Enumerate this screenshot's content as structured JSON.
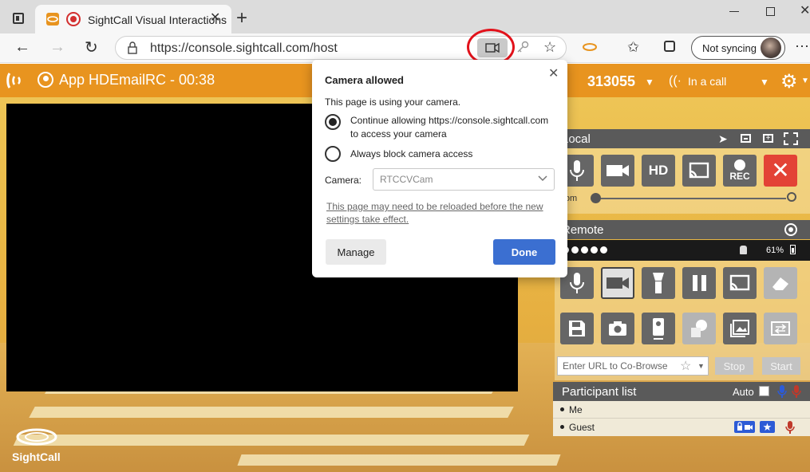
{
  "browser": {
    "tab_title": "SightCall Visual Interactions",
    "url": "https://console.sightcall.com/host",
    "sync_label": "Not syncing"
  },
  "app": {
    "title": "App HDEmailRC - 00:38",
    "call_id": "313055",
    "call_status": "In a call",
    "logo_text": "SightCall",
    "accent_color": "#e8941f"
  },
  "local_panel": {
    "title": "Local",
    "zoom_label": "Zoom",
    "hd_label": "HD",
    "rec_label": "REC"
  },
  "remote_panel": {
    "title": "Remote",
    "battery": "61%",
    "signal_dots": 5,
    "cobrowse_placeholder": "Enter URL to Co-Browse",
    "stop_label": "Stop",
    "start_label": "Start"
  },
  "participants": {
    "title": "Participant list",
    "auto_label": "Auto",
    "list": [
      {
        "name": "Me"
      },
      {
        "name": "Guest"
      }
    ]
  },
  "camera_dialog": {
    "title": "Camera allowed",
    "message": "This page is using your camera.",
    "option_allow_line1": "Continue allowing https://console.sightcall.com",
    "option_allow_line2": "to access your camera",
    "option_block": "Always block camera access",
    "camera_label": "Camera:",
    "camera_value": "RTCCVCam",
    "reload_note_line1": "This page may need to be reloaded before the new",
    "reload_note_line2": "settings take effect.",
    "manage_label": "Manage",
    "done_label": "Done"
  }
}
